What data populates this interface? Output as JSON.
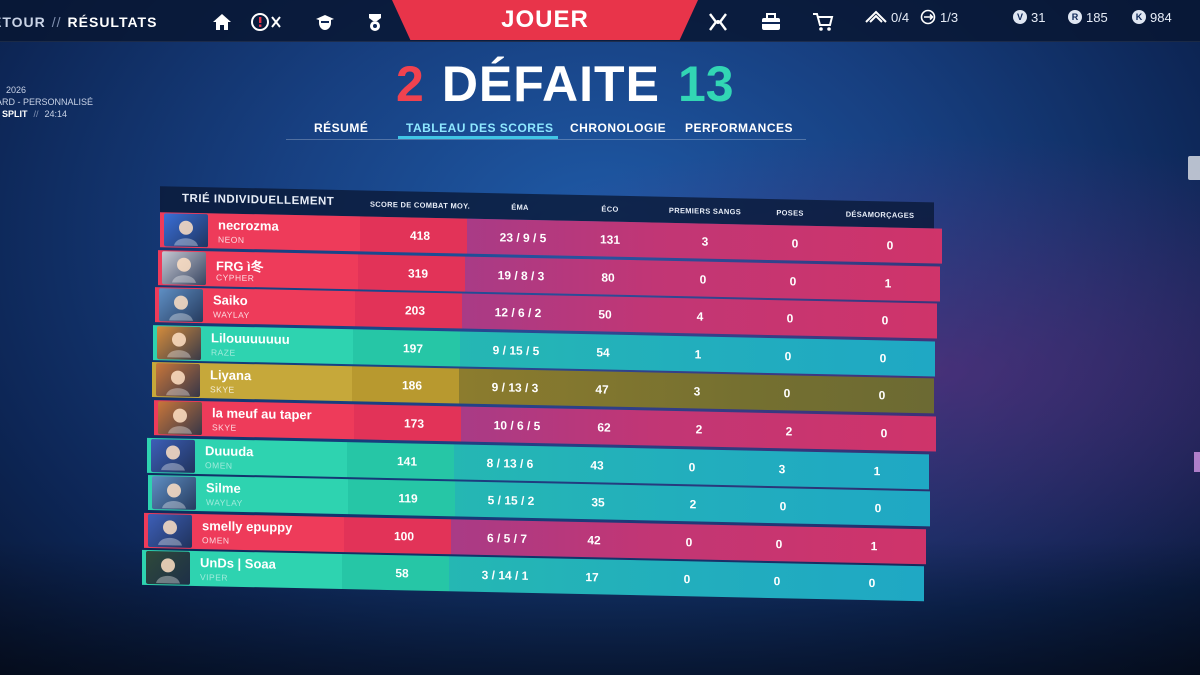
{
  "breadcrumb": {
    "back": "ETOUR",
    "separator": "//",
    "current": "RÉSULTATS"
  },
  "play_button": {
    "label": "JOUER"
  },
  "currencies": [
    {
      "icon": "battlepass-icon",
      "value": "0/4"
    },
    {
      "icon": "mission-icon",
      "value": "1/3"
    },
    {
      "icon": "valorant-points-icon",
      "value": "31"
    },
    {
      "icon": "radianite-icon",
      "value": "185"
    },
    {
      "icon": "kingdom-credits-icon",
      "value": "984"
    }
  ],
  "match_meta": {
    "date": "2026",
    "mode": "ARD - PERSONNALISÉ",
    "map": "SPLIT",
    "separator": "//",
    "duration": "24:14"
  },
  "result": {
    "team_score": "2",
    "outcome": "DÉFAITE",
    "enemy_score": "13"
  },
  "tabs": [
    {
      "label": "RÉSUMÉ",
      "active": false
    },
    {
      "label": "TABLEAU DES SCORES",
      "active": true
    },
    {
      "label": "CHRONOLOGIE",
      "active": false
    },
    {
      "label": "PERFORMANCES",
      "active": false
    }
  ],
  "scoreboard": {
    "sort_label": "TRIÉ INDIVIDUELLEMENT",
    "columns": [
      "SCORE DE COMBAT MOY.",
      "ÉMA",
      "ÉCO",
      "PREMIERS SANGS",
      "POSES",
      "DÉSAMORÇAGES"
    ],
    "rows": [
      {
        "team": "red",
        "name": "necrozma",
        "agent": "NEON",
        "acs": "418",
        "kda": "23 / 9 / 5",
        "econ": "131",
        "first_bloods": "3",
        "plants": "0",
        "defuses": "0",
        "avatar_color": "#3a6fd8"
      },
      {
        "team": "red",
        "name": "FRG ì冬",
        "agent": "CYPHER",
        "acs": "319",
        "kda": "19 / 8 / 3",
        "econ": "80",
        "first_bloods": "0",
        "plants": "0",
        "defuses": "1",
        "avatar_color": "#c7c9d3"
      },
      {
        "team": "red",
        "name": "Saiko",
        "agent": "WAYLAY",
        "acs": "203",
        "kda": "12 / 6 / 2",
        "econ": "50",
        "first_bloods": "4",
        "plants": "0",
        "defuses": "0",
        "avatar_color": "#5f8fc4"
      },
      {
        "team": "teal",
        "name": "Lilouuuuuuu",
        "agent": "RAZE",
        "acs": "197",
        "kda": "9 / 15 / 5",
        "econ": "54",
        "first_bloods": "1",
        "plants": "0",
        "defuses": "0",
        "avatar_color": "#d58c3c"
      },
      {
        "team": "self",
        "name": "Liyana",
        "agent": "SKYE",
        "acs": "186",
        "kda": "9 / 13 / 3",
        "econ": "47",
        "first_bloods": "3",
        "plants": "0",
        "defuses": "0",
        "avatar_color": "#c9763a"
      },
      {
        "team": "red",
        "name": "la meuf au taper",
        "agent": "SKYE",
        "acs": "173",
        "kda": "10 / 6 / 5",
        "econ": "62",
        "first_bloods": "2",
        "plants": "2",
        "defuses": "0",
        "avatar_color": "#c9763a"
      },
      {
        "team": "teal",
        "name": "Duuuda",
        "agent": "OMEN",
        "acs": "141",
        "kda": "8 / 13 / 6",
        "econ": "43",
        "first_bloods": "0",
        "plants": "3",
        "defuses": "1",
        "avatar_color": "#3d5fb8"
      },
      {
        "team": "teal",
        "name": "Silme",
        "agent": "WAYLAY",
        "acs": "119",
        "kda": "5 / 15 / 2",
        "econ": "35",
        "first_bloods": "2",
        "plants": "0",
        "defuses": "0",
        "avatar_color": "#5f8fc4"
      },
      {
        "team": "red",
        "name": "smelly epuppy",
        "agent": "OMEN",
        "acs": "100",
        "kda": "6 / 5 / 7",
        "econ": "42",
        "first_bloods": "0",
        "plants": "0",
        "defuses": "1",
        "avatar_color": "#3d5fb8"
      },
      {
        "team": "teal",
        "name": "UnDs | Soaa",
        "agent": "VIPER",
        "acs": "58",
        "kda": "3 / 14 / 1",
        "econ": "17",
        "first_bloods": "0",
        "plants": "0",
        "defuses": "0",
        "avatar_color": "#2f4a3a"
      }
    ]
  }
}
